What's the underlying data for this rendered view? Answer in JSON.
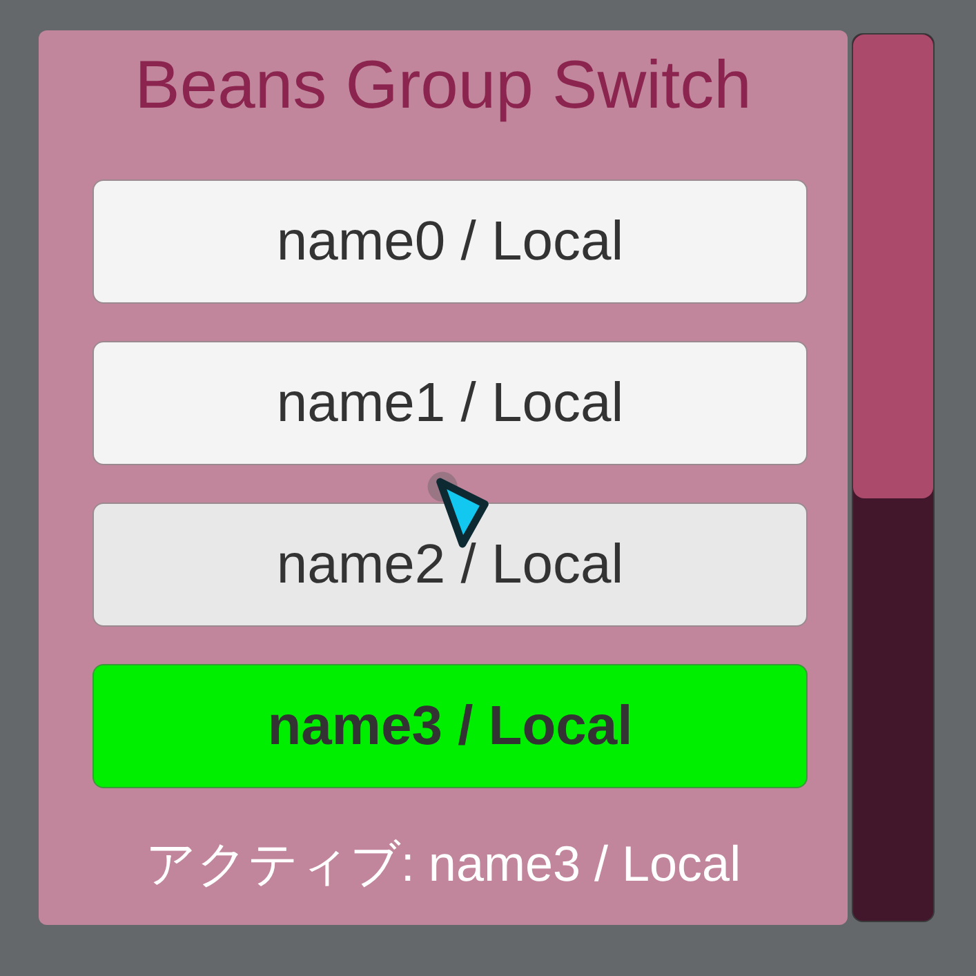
{
  "panel": {
    "title": "Beans Group Switch"
  },
  "buttons": [
    {
      "label": "name0 / Local",
      "selected": false,
      "hovered": false
    },
    {
      "label": "name1 / Local",
      "selected": false,
      "hovered": false
    },
    {
      "label": "name2 / Local",
      "selected": false,
      "hovered": true
    },
    {
      "label": "name3 / Local",
      "selected": true,
      "hovered": false
    }
  ],
  "status": "アクティブ: name3 / Local"
}
